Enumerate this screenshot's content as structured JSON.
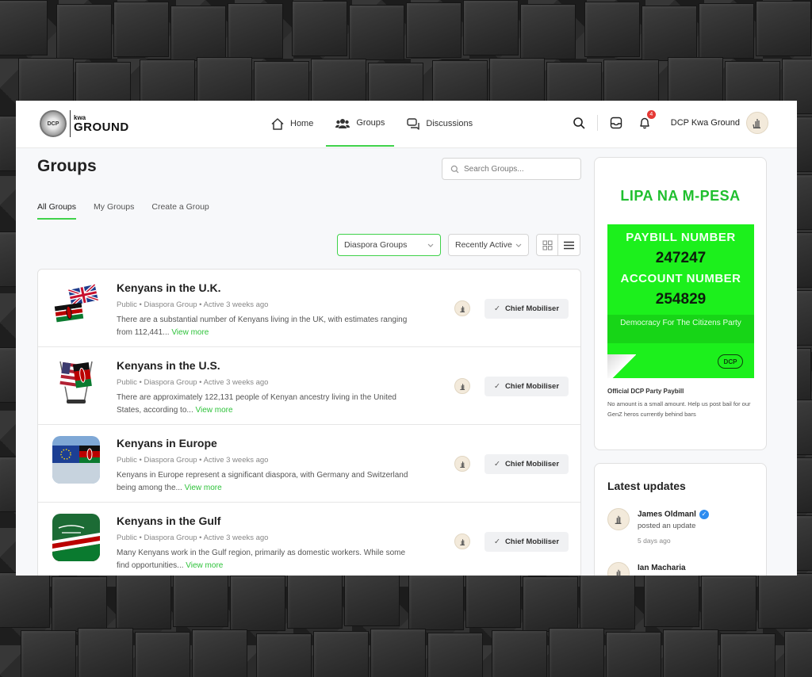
{
  "header": {
    "logo_kwa": "kwa",
    "logo_ground": "GROUND",
    "logo_seal": "DCP",
    "nav": [
      {
        "label": "Home",
        "icon": "home-icon"
      },
      {
        "label": "Groups",
        "icon": "users-icon"
      },
      {
        "label": "Discussions",
        "icon": "chat-icon"
      }
    ],
    "notifications_count": "4",
    "username": "DCP Kwa Ground"
  },
  "main": {
    "title": "Groups",
    "search_placeholder": "Search Groups...",
    "tabs": [
      "All Groups",
      "My Groups",
      "Create a Group"
    ],
    "filter_type": "Diaspora Groups",
    "filter_sort": "Recently Active",
    "groups": [
      {
        "name": "Kenyans in the U.K.",
        "meta": "Public • Diaspora Group • Active 3 weeks ago",
        "description": "There are a substantial number of Kenyans living in the UK, with estimates ranging from 112,441...",
        "more": "View more",
        "role": "Chief Mobiliser"
      },
      {
        "name": "Kenyans in the U.S.",
        "meta": "Public • Diaspora Group • Active 3 weeks ago",
        "description": "There are approximately 122,131 people of Kenyan ancestry living in the United States, according to...",
        "more": "View more",
        "role": "Chief Mobiliser"
      },
      {
        "name": "Kenyans in Europe",
        "meta": "Public • Diaspora Group • Active 3 weeks ago",
        "description": "Kenyans in Europe represent a significant diaspora, with Germany and Switzerland being among the...",
        "more": "View more",
        "role": "Chief Mobiliser"
      },
      {
        "name": "Kenyans in the Gulf",
        "meta": "Public • Diaspora Group • Active 3 weeks ago",
        "description": "Many Kenyans work in the Gulf region, primarily as domestic workers. While some find opportunities...",
        "more": "View more",
        "role": "Chief Mobiliser"
      }
    ]
  },
  "sidebar": {
    "lipa_title": "LIPA NA M-PESA",
    "paybill_label": "PAYBILL NUMBER",
    "paybill_number": "247247",
    "account_label": "ACCOUNT NUMBER",
    "account_number": "254829",
    "tagline": "Democracy For The Citizens Party",
    "dcp_mark": "DCP",
    "caption": "Official DCP Party Paybill",
    "note": "No amount is a small amount. Help us post bail for our GenZ heros currently behind bars",
    "updates_title": "Latest updates",
    "updates": [
      {
        "name": "James Oldmanl",
        "action": "posted an update",
        "time": "5 days ago"
      },
      {
        "name": "Ian Macharia",
        "action": "",
        "time": ""
      }
    ]
  },
  "colors": {
    "accent": "#3fd24a",
    "link": "#2ec23a",
    "mpesa_green": "#1cf01c"
  }
}
